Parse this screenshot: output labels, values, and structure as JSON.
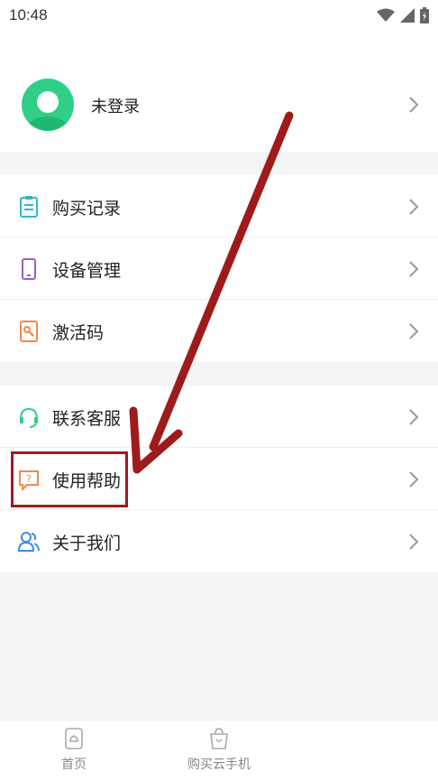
{
  "status_bar": {
    "time": "10:48"
  },
  "profile": {
    "name": "未登录"
  },
  "groups": [
    {
      "items": [
        {
          "label": "购买记录",
          "icon": "receipt-icon"
        },
        {
          "label": "设备管理",
          "icon": "phone-icon"
        },
        {
          "label": "激活码",
          "icon": "code-icon"
        }
      ]
    },
    {
      "items": [
        {
          "label": "联系客服",
          "icon": "headset-icon"
        },
        {
          "label": "使用帮助",
          "icon": "help-icon"
        },
        {
          "label": "关于我们",
          "icon": "users-icon"
        }
      ]
    }
  ],
  "tabbar": {
    "home_label": "首页",
    "buy_label": "购买云手机"
  },
  "colors": {
    "accent": "#2fcf88",
    "annotation": "#9e1b1b",
    "background": "#f5f5f5"
  }
}
